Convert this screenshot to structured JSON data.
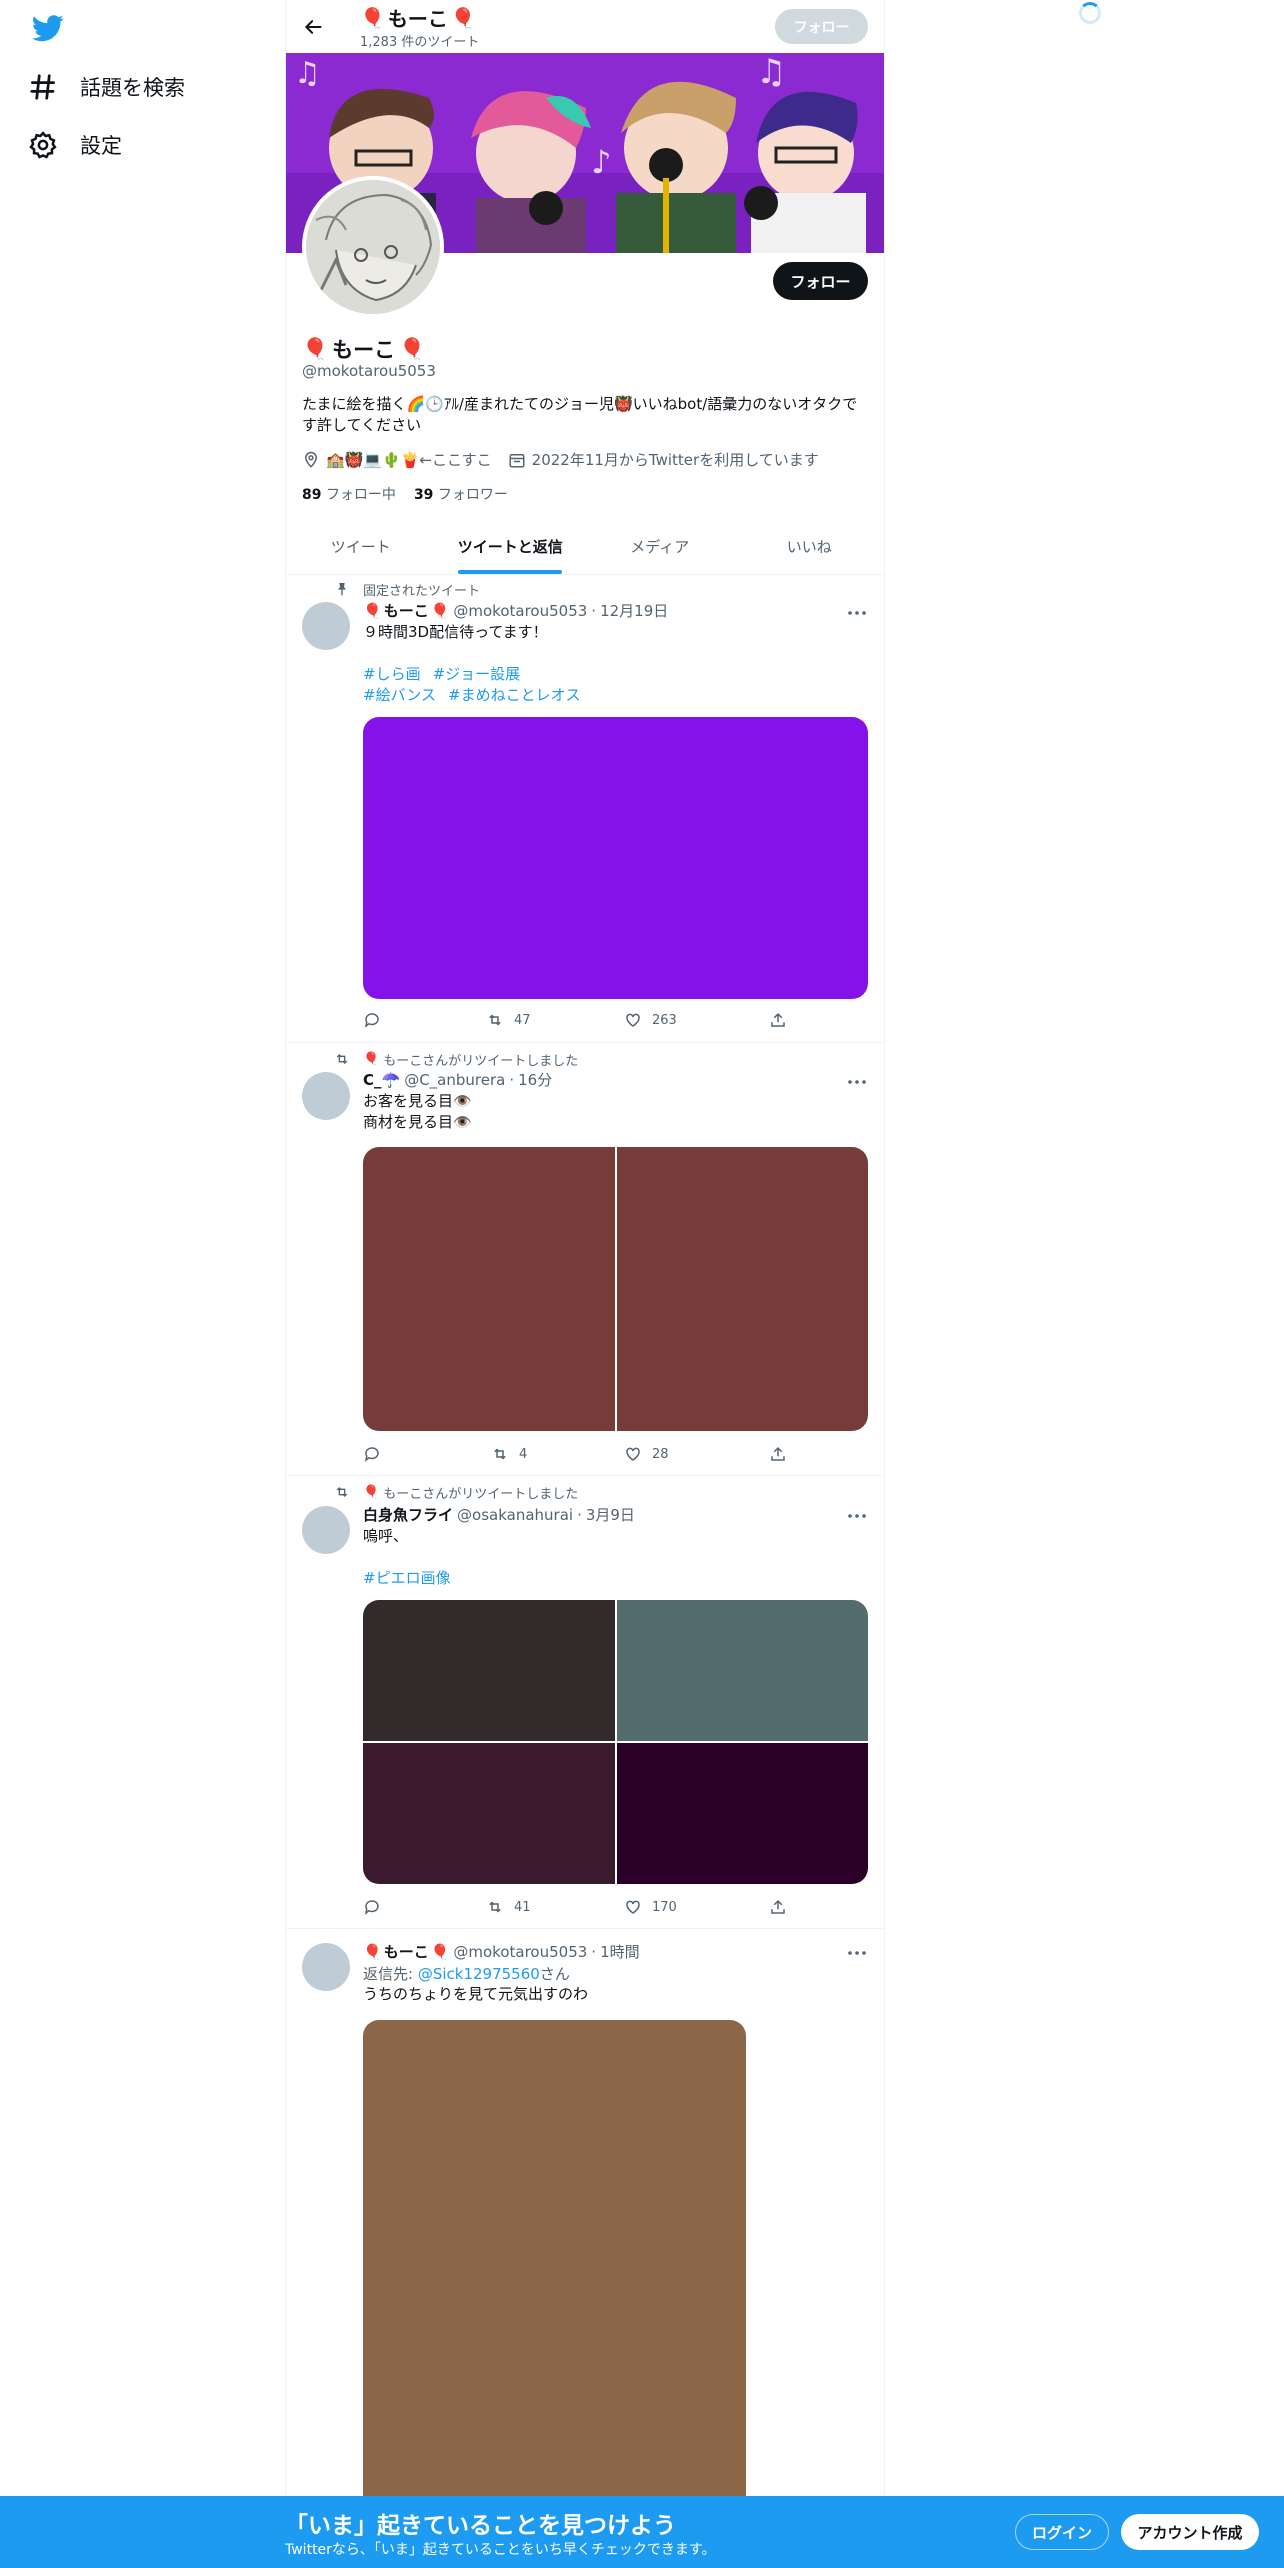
{
  "sidebar": {
    "items": [
      {
        "label": "話題を検索",
        "icon": "hashtag-icon"
      },
      {
        "label": "設定",
        "icon": "gear-icon"
      }
    ]
  },
  "header": {
    "name": "もーこ",
    "tweet_count": "1,283 件のツイート",
    "follow_label": "フォロー"
  },
  "profile": {
    "name": "もーこ",
    "handle": "@mokotarou5053",
    "follow_label": "フォロー",
    "bio": "たまに絵を描く🌈🕒ｱﾙ/産まれたてのジョー児👹いいねbot/語彙力のないオタクです許してください",
    "location": "🏫👹💻🌵🍟←ここすこ",
    "joined": "2022年11月からTwitterを利用しています",
    "following_count": "89",
    "following_label": "フォロー中",
    "followers_count": "39",
    "followers_label": "フォロワー"
  },
  "tabs": [
    {
      "label": "ツイート",
      "active": false
    },
    {
      "label": "ツイートと返信",
      "active": true
    },
    {
      "label": "メディア",
      "active": false
    },
    {
      "label": "いいね",
      "active": false
    }
  ],
  "tweets": [
    {
      "context": "固定されたツイート",
      "name": "もーこ",
      "handle": "@mokotarou5053",
      "date": "12月19日",
      "text": "９時間3D配信待ってます！",
      "hashtags_line1": [
        "#しら画",
        "#ジョー設展"
      ],
      "hashtags_line2": [
        "#絵バンス",
        "#まめねことレオス"
      ],
      "media_color": "#8512e8",
      "retweets": "47",
      "likes": "263"
    },
    {
      "context": "もーこさんがリツイートしました",
      "name": "C_☂️",
      "handle": "@C_anburera",
      "date": "16分",
      "text_line1": "お客を見る目👁️",
      "text_line2": "商材を見る目👁️",
      "media_colors": [
        "#763c3a",
        "#763c3a"
      ],
      "retweets": "4",
      "likes": "28"
    },
    {
      "context": "もーこさんがリツイートしました",
      "name": "白身魚フライ",
      "handle": "@osakanahurai",
      "date": "3月9日",
      "text": "嗚呼、",
      "hashtag": "#ピエロ画像",
      "media_colors": [
        "#332b2b",
        "#536c6e",
        "#3a1a2c",
        "#2b0028"
      ],
      "retweets": "41",
      "likes": "170"
    },
    {
      "name": "もーこ",
      "handle": "@mokotarou5053",
      "date": "1時間",
      "reply_prefix": "返信先: ",
      "reply_to": "@Sick12975560",
      "reply_suffix": "さん",
      "text": "うちのちょりを見て元気出すのわ",
      "media_color": "#8c6649"
    }
  ],
  "bottom": {
    "title": "「いま」起きていることを見つけよう",
    "subtitle": "Twitterなら、「いま」起きていることをいち早くチェックできます。",
    "login_label": "ログイン",
    "signup_label": "アカウント作成"
  },
  "colors": {
    "accent": "#1d9bf0",
    "banner_bg": "#8a2ad0"
  }
}
